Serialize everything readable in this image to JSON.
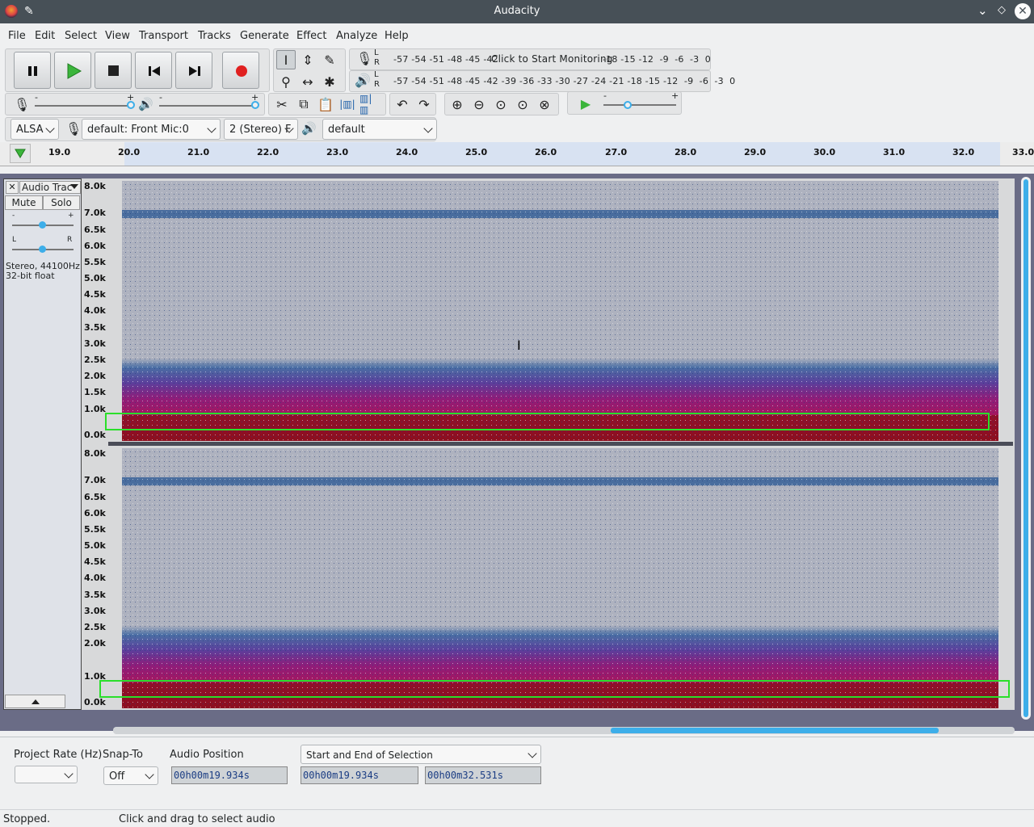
{
  "window": {
    "title": "Audacity"
  },
  "menu": [
    "File",
    "Edit",
    "Select",
    "View",
    "Transport",
    "Tracks",
    "Generate",
    "Effect",
    "Analyze",
    "Help"
  ],
  "meters": {
    "record_scale": "-57 -54 -51 -48 -45 -42",
    "record_prompt": "Click to Start Monitoring",
    "record_scale_right": "-18 -15 -12  -9  -6  -3  0",
    "play_scale": "-57 -54 -51 -48 -45 -42 -39 -36 -33 -30 -27 -24 -21 -18 -15 -12  -9  -6  -3  0",
    "lr": "L\nR"
  },
  "mixer": {
    "minus": "-",
    "plus": "+"
  },
  "device": {
    "host": "ALSA",
    "input": "default: Front Mic:0",
    "channels": "2 (Stereo) F",
    "output": "default"
  },
  "ruler": {
    "ticks": [
      "19.0",
      "20.0",
      "21.0",
      "22.0",
      "23.0",
      "24.0",
      "25.0",
      "26.0",
      "27.0",
      "28.0",
      "29.0",
      "30.0",
      "31.0",
      "32.0",
      "33.0"
    ]
  },
  "track": {
    "name": "Audio Trac",
    "mute": "Mute",
    "solo": "Solo",
    "gain_min": "-",
    "gain_max": "+",
    "pan_left": "L",
    "pan_right": "R",
    "info_line1": "Stereo, 44100Hz",
    "info_line2": "32-bit float",
    "freq_labels": [
      "8.0k",
      "7.0k",
      "6.5k",
      "6.0k",
      "5.5k",
      "5.0k",
      "4.5k",
      "4.0k",
      "3.5k",
      "3.0k",
      "2.5k",
      "2.0k",
      "1.5k",
      "1.0k",
      "0.0k"
    ],
    "freq_labels_lower": [
      "8.0k",
      "7.0k",
      "6.5k",
      "6.0k",
      "5.5k",
      "5.0k",
      "4.5k",
      "4.0k",
      "3.5k",
      "3.0k",
      "2.5k",
      "2.0k",
      "1.0k",
      "0.0k"
    ]
  },
  "selection_bar": {
    "project_rate_label": "Project Rate (Hz)",
    "project_rate_value": "",
    "snap_to_label": "Snap-To",
    "snap_to_value": "Off",
    "audio_position_label": "Audio Position",
    "audio_position_value": "00h00m19.934s",
    "selection_mode": "Start and End of Selection",
    "selection_start": "00h00m19.934s",
    "selection_end": "00h00m32.531s"
  },
  "status": {
    "state": "Stopped.",
    "hint": "Click and drag to select audio"
  },
  "colors": {
    "accent": "#3daee9",
    "selection_box": "#2adf2a",
    "record": "#e02020",
    "play": "#3bb53b"
  }
}
